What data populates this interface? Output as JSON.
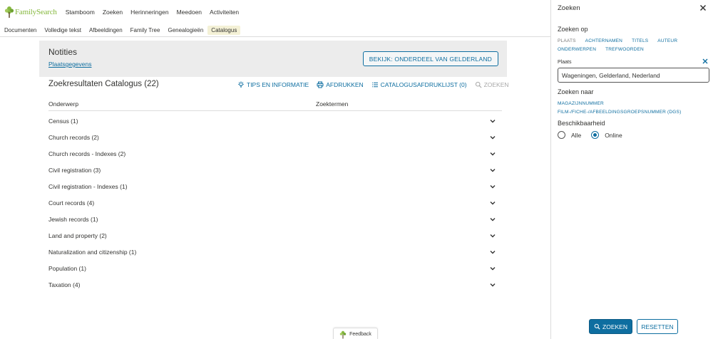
{
  "brand": {
    "logo_text": "FamilySearch",
    "accent": "#87b940",
    "link_color": "#0e6ea0"
  },
  "nav": {
    "items": [
      "Stamboom",
      "Zoeken",
      "Herinneringen",
      "Meedoen",
      "Activiteiten"
    ]
  },
  "top_icons": [
    "location-pin-icon",
    "globe-icon",
    "help-icon",
    "chat-icon",
    "bell-icon"
  ],
  "subnav": {
    "items": [
      "Documenten",
      "Volledige tekst",
      "Afbeeldingen",
      "Family Tree",
      "Genealogieën",
      "Catalogus"
    ],
    "active": "Catalogus"
  },
  "notes": {
    "title": "Notities",
    "link": "Plaatsgegevens",
    "button": "BEKIJK: ONDERDEEL VAN GELDERLAND"
  },
  "results": {
    "title": "Zoekresultaten Catalogus (22)",
    "tools": {
      "tips": "TIPS EN INFORMATIE",
      "print": "AFDRUKKEN",
      "printlist": "CATALOGUSAFDRUKLIJST (0)",
      "search": "ZOEKEN"
    },
    "columns": {
      "subject": "Onderwerp",
      "terms": "Zoektermen"
    },
    "rows": [
      "Census (1)",
      "Church records (2)",
      "Church records - Indexes (2)",
      "Civil registration (3)",
      "Civil registration - Indexes (1)",
      "Court records (4)",
      "Jewish records (1)",
      "Land and property (2)",
      "Naturalization and citizenship (1)",
      "Population (1)",
      "Taxation (4)"
    ]
  },
  "feedback": "Feedback",
  "panel": {
    "title": "Zoeken",
    "search_on": {
      "title": "Zoeken op",
      "options_row1": [
        "PLAATS",
        "ACHTERNAMEN",
        "TITELS",
        "AUTEUR"
      ],
      "options_row2": [
        "ONDERWERPEN",
        "TREFWOORDEN"
      ],
      "selected": "PLAATS"
    },
    "place": {
      "label": "Plaats",
      "value": "Wageningen, Gelderland, Nederland"
    },
    "search_for": {
      "title": "Zoeken naar",
      "options": [
        "MAGAZIJNNUMMER",
        "FILM-/FICHE-/AFBEELDINGSGROEPSNUMMER (DGS)"
      ]
    },
    "availability": {
      "title": "Beschikbaarheid",
      "options": [
        "Alle",
        "Online"
      ],
      "selected": "Online"
    },
    "search_button": "ZOEKEN",
    "reset_button": "RESETTEN"
  }
}
